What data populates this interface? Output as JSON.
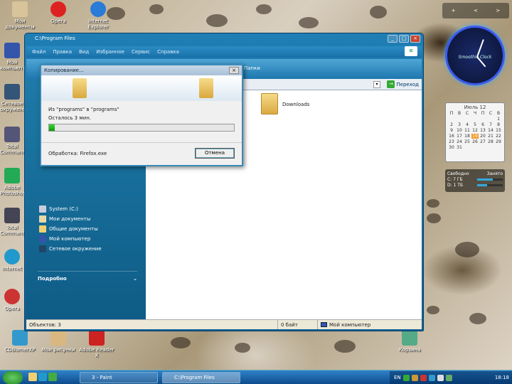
{
  "desktop_icons": [
    {
      "label": "Мои документы",
      "icon": "documents-icon",
      "color": "#d8c49a"
    },
    {
      "label": "Opera",
      "icon": "opera-icon",
      "color": "#d22"
    },
    {
      "label": "Internet Explorer",
      "icon": "ie-icon",
      "color": "#2a7ad8"
    },
    {
      "label": "Мой компьютер",
      "icon": "computer-icon",
      "color": "#35a"
    },
    {
      "label": "Сетевое окружение",
      "icon": "network-icon",
      "color": "#357"
    },
    {
      "label": "Total Commander",
      "icon": "total-commander-icon",
      "color": "#557"
    },
    {
      "label": "Adobe Photoshop",
      "icon": "photoshop-icon",
      "color": "#2a5"
    },
    {
      "label": "Total Commander",
      "icon": "total-commander-icon-2",
      "color": "#445"
    },
    {
      "label": "Internet",
      "icon": "internet-icon",
      "color": "#29c"
    },
    {
      "label": "Opera",
      "icon": "opera-icon-2",
      "color": "#c33"
    },
    {
      "label": "CDBurnerXP",
      "icon": "cdburner-icon",
      "color": "#39c"
    },
    {
      "label": "Мои рисунки",
      "icon": "pictures-icon",
      "color": "#d8b880"
    },
    {
      "label": "Adobe Reader X",
      "icon": "adobe-reader-icon",
      "color": "#c22"
    },
    {
      "label": "Корзина",
      "icon": "recycle-bin-icon",
      "color": "#5a8"
    }
  ],
  "window": {
    "title": "C:\\Program Files",
    "menu": [
      "Файл",
      "Правка",
      "Вид",
      "Избранное",
      "Сервис",
      "Справка"
    ],
    "folders_label": "Папки",
    "go_label": "Переход",
    "sidebar_links": [
      "System (C:)",
      "Мои документы",
      "Общие документы",
      "Мой компьютер",
      "Сетевое окружение"
    ],
    "details_label": "Подробно",
    "content_items": [
      {
        "label": "Downloads"
      }
    ],
    "status": {
      "objects": "Объектов: 3",
      "size": "0 байт",
      "location": "Мой компьютер"
    }
  },
  "copy_dialog": {
    "title": "Копирование...",
    "from_to": "Из \"programs\" в \"programs\"",
    "remaining": "Осталось 3 мин.",
    "progress": 0.03,
    "processing": "Обработка: Firefox.exe",
    "cancel_label": "Отмена"
  },
  "gadgets": {
    "controls": [
      "+",
      "<",
      ">"
    ],
    "clock_label": "Smoothie Clock",
    "calendar": {
      "month": "Июль 12",
      "weekdays": [
        "П",
        "В",
        "С",
        "Ч",
        "П",
        "С",
        "В"
      ],
      "days": [
        "",
        "",
        "",
        "",
        "",
        "",
        "1",
        "2",
        "3",
        "4",
        "5",
        "6",
        "7",
        "8",
        "9",
        "10",
        "11",
        "12",
        "13",
        "14",
        "15",
        "16",
        "17",
        "18",
        "19",
        "20",
        "21",
        "22",
        "23",
        "24",
        "25",
        "26",
        "27",
        "28",
        "29",
        "30",
        "31"
      ],
      "today": "19"
    },
    "drives": {
      "free_label": "Свободно",
      "used_label": "Занято",
      "rows": [
        {
          "drive": "C: 7 ГБ",
          "fill": 0.6
        },
        {
          "drive": "D: 1 ТБ",
          "fill": 0.4
        }
      ]
    }
  },
  "taskbar": {
    "tasks": [
      {
        "label": "3 - Paint",
        "active": false
      },
      {
        "label": "C:\\Program Files",
        "active": true
      }
    ],
    "lang": "EN",
    "time": "18:18"
  }
}
